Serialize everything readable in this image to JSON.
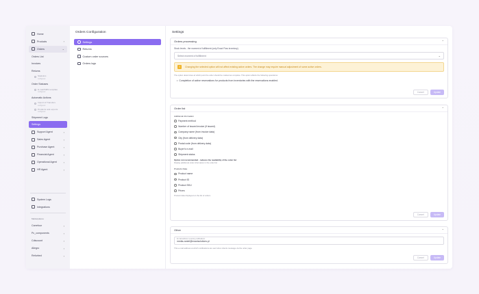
{
  "sidebar": {
    "items": [
      {
        "label": "Home"
      },
      {
        "label": "Products"
      },
      {
        "label": "Orders"
      }
    ],
    "orders_sub": [
      {
        "label": "Orders List"
      },
      {
        "label": "Invoices"
      },
      {
        "label": "Returns"
      }
    ],
    "statistics": {
      "title": "Statistics",
      "caption": "configured"
    },
    "order_statuses": "Order Statuses",
    "email_template": {
      "title": "E-mail/SMS template",
      "caption": "configured"
    },
    "automatic_actions": "Automatic Actions",
    "import_transfers": {
      "title": "Import of Transfers",
      "caption": "configured"
    },
    "products_exports": {
      "title": "Products and exports",
      "caption": "configured"
    },
    "shipment_logs": "Shipment Logs",
    "settings": "Settings",
    "agents": [
      {
        "label": "Support Agent"
      },
      {
        "label": "Sales Agent"
      },
      {
        "label": "Purchase Agent"
      },
      {
        "label": "Financial Agent"
      },
      {
        "label": "Operational Agent"
      },
      {
        "label": "HR Agent"
      }
    ],
    "bottom": [
      {
        "label": "System Logs"
      },
      {
        "label": "Integrations"
      }
    ],
    "marketplaces_heading": "Marketplaces",
    "marketplaces": [
      {
        "label": "Carrefour"
      },
      {
        "label": "Pc_components"
      },
      {
        "label": "Cdiscount"
      },
      {
        "label": "Allegro"
      },
      {
        "label": "Refurbed"
      }
    ]
  },
  "config": {
    "title": "Orders Configuration",
    "items": [
      {
        "label": "Settings"
      },
      {
        "label": "Returns"
      },
      {
        "label": "Custom order sources"
      },
      {
        "label": "Orders logs"
      }
    ]
  },
  "main": {
    "title": "Settings",
    "processing": {
      "title": "Orders processing",
      "stock_label": "Stock levels - the moment of fulfillment (only Exact Flow inventory)",
      "select_placeholder": "Select moment of fulfillment",
      "warning": "Changing the selected option will not affect existing active orders. The change may require manual adjustment of some active orders.",
      "hint": "The option determines at which point the order should be marked as complete. This option affects the following operations:",
      "bullet": "Completion of active reservations for products from inventories with the reservations enabled.",
      "cancel": "Cancel",
      "update": "Update"
    },
    "order_list": {
      "title": "Order list",
      "additional_label": "Additional information",
      "options": [
        "Payment method",
        "Number of issued invoice (if issued)",
        "Company name (from invoice data)",
        "City (from delivery data)",
        "Postal code (from delivery data)",
        "Buyer's e-mail",
        "Shipment status"
      ],
      "not_recommended": "Option not recommended - reduces the readability of the order list",
      "display_hint": "Display additional order information in the order list",
      "product_label": "Products Data",
      "product_options": [
        "Product name",
        "Product ID",
        "Product SKU",
        "Prices"
      ],
      "product_hint": "Product data displayed on the list of orders",
      "cancel": "Cancel",
      "update": "Update"
    },
    "other": {
      "title": "Other",
      "email_label": "E-mail address receiving notifications",
      "email_value": "media.zaniel@exactsolutions.pl",
      "email_hint": "This e-mail address at which notifications are sent when clients message via the order page.",
      "cancel": "Cancel",
      "update": "Update"
    }
  }
}
